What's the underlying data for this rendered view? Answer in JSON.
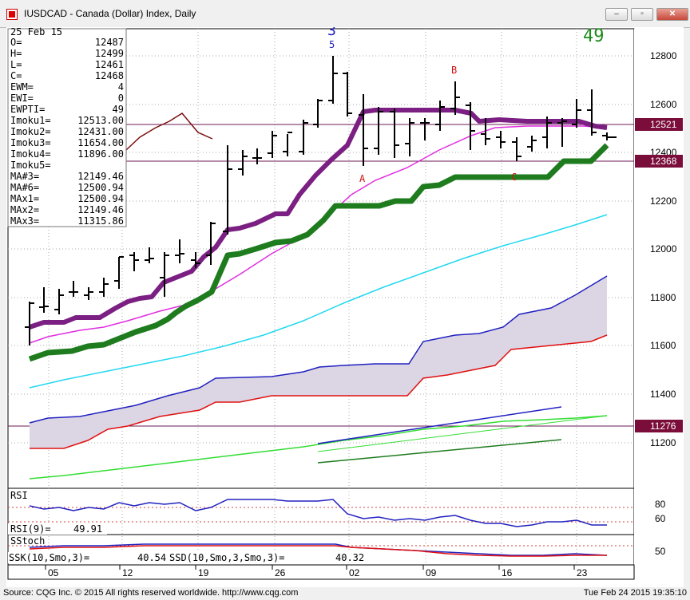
{
  "window": {
    "title": "IUSDCAD - Canada (Dollar) Index, Daily",
    "minimize_label": "–",
    "maximize_label": "▫",
    "close_label": "✕"
  },
  "data_box": {
    "rows": [
      {
        "label": "25 Feb 15",
        "value": ""
      },
      {
        "label": "O=",
        "value": "12487"
      },
      {
        "label": "H=",
        "value": "12499"
      },
      {
        "label": "L=",
        "value": "12461"
      },
      {
        "label": "C=",
        "value": "12468"
      },
      {
        "label": "EWM=",
        "value": "4"
      },
      {
        "label": "EWI=",
        "value": "0"
      },
      {
        "label": "EWPTI=",
        "value": "49"
      },
      {
        "label": "Imoku1=",
        "value": "12513.00"
      },
      {
        "label": "Imoku2=",
        "value": "12431.00"
      },
      {
        "label": "Imoku3=",
        "value": "11654.00"
      },
      {
        "label": "Imoku4=",
        "value": "11896.00"
      },
      {
        "label": "Imoku5=",
        "value": ""
      },
      {
        "label": "MA#3=",
        "value": "12149.46"
      },
      {
        "label": "MA#6=",
        "value": "12500.94"
      },
      {
        "label": "MAx1=",
        "value": "12500.94"
      },
      {
        "label": "MAx2=",
        "value": "12149.46"
      },
      {
        "label": "MAx3=",
        "value": "11315.86"
      }
    ]
  },
  "wave_labels": {
    "top_3": "3",
    "top_5": "5",
    "ewpti_value": "49",
    "A": "A",
    "B": "B",
    "C": "C"
  },
  "price_axis": {
    "ticks": [
      "12800",
      "12600",
      "12400",
      "12200",
      "12000",
      "11800",
      "11600",
      "11400",
      "11200"
    ],
    "current_high_tag": "12521",
    "current_low_tag": "12368",
    "support_tag": "11276"
  },
  "rsi_panel": {
    "label": "RSI",
    "value_label": "RSI(9)=",
    "value": "49.91",
    "levels": [
      "80",
      "60"
    ]
  },
  "sstoch_panel": {
    "label": "SStoch",
    "ssk_label": "SSK(10,Smo,3)=",
    "ssk_value": "40.54",
    "ssd_label": "SSD(10,Smo,3,Smo,3)=",
    "ssd_value": "40.32",
    "level": "50"
  },
  "date_axis": {
    "ticks": [
      "05",
      "12",
      "19",
      "26",
      "02",
      "09",
      "16",
      "23"
    ]
  },
  "colors": {
    "purple_line": "#7b1f83",
    "green_line": "#1e7c1e",
    "magenta_ma": "#e02ee0",
    "cyan_ma": "#22d8f0",
    "cloud_top": "#2020c0",
    "cloud_bottom": "#e01010",
    "light_green": "#33dd33",
    "dark_red": "#7a0f0f",
    "hline": "#6b1a56",
    "tag_bg": "#7a0d3a"
  },
  "footer": {
    "source": "Source: CQG Inc. © 2015 All rights reserved worldwide. http://www.cqg.com",
    "timestamp": "Tue Feb 24 2015 19:35:10"
  }
}
